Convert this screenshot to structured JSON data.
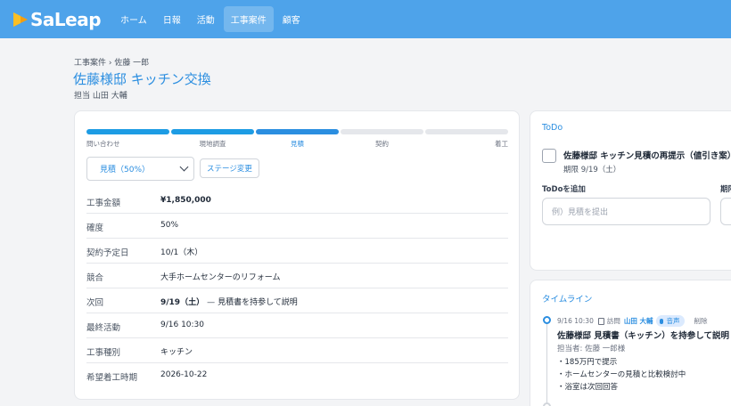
{
  "colors": {
    "header": "#4ea3ea",
    "accent": "#2b8ee0",
    "stage_done": "#1d9ce4"
  },
  "brand": {
    "name": "SaLeap",
    "icon": "play-triangle-logo-icon"
  },
  "nav": {
    "items": [
      {
        "label": "ホーム",
        "active": false
      },
      {
        "label": "日報",
        "active": false
      },
      {
        "label": "活動",
        "active": false
      },
      {
        "label": "工事案件",
        "active": true
      },
      {
        "label": "顧客",
        "active": false
      }
    ]
  },
  "page": {
    "breadcrumb": "工事案件 › 佐藤 一郎",
    "title": "佐藤様邸 キッチン交換",
    "owner": "担当 山田 大輔"
  },
  "pipeline": {
    "stages": [
      {
        "label": "問い合わせ",
        "state": "done"
      },
      {
        "label": "現地調査",
        "state": "done"
      },
      {
        "label": "見積",
        "state": "current"
      },
      {
        "label": "契約",
        "state": "todo"
      },
      {
        "label": "着工",
        "state": "todo"
      }
    ],
    "selected_stage": "見積（50%）",
    "change_button": "ステージ変更"
  },
  "details": {
    "rows": [
      {
        "label": "工事金額",
        "value": "¥1,850,000"
      },
      {
        "label": "確度",
        "value": "50%"
      },
      {
        "label": "契約予定日",
        "value": "10/1（木）"
      },
      {
        "label": "競合",
        "value": "大手ホームセンターのリフォーム"
      },
      {
        "label": "次回",
        "date": "9/19（土）",
        "sep": "—",
        "value": "見積書を持参して説明"
      },
      {
        "label": "最終活動",
        "value": "9/16 10:30"
      },
      {
        "label": "工事種別",
        "value": "キッチン"
      },
      {
        "label": "希望着工時期",
        "value": "2026-10-22"
      }
    ]
  },
  "todo": {
    "heading": "ToDo",
    "item_title": "佐藤様邸 キッチン見積の再提示（値引き案）",
    "item_due": "期限 9/19（土）",
    "add_label": "ToDoを追加",
    "add_placeholder": "例）見積を提出",
    "due_label": "期限"
  },
  "timeline": {
    "heading": "タイムライン",
    "entry": {
      "datetime": "9/16 10:30",
      "type": "訪問",
      "author": "山田 大輔",
      "badge": "音声",
      "delete": "削除",
      "title": "佐藤様邸 見積書（キッチン）を持参して説明",
      "contact": "担当者: 佐藤 一郎様",
      "notes": [
        "・185万円で提示",
        "・ホームセンターの見積と比較検討中",
        "・浴室は次回回答"
      ]
    }
  }
}
